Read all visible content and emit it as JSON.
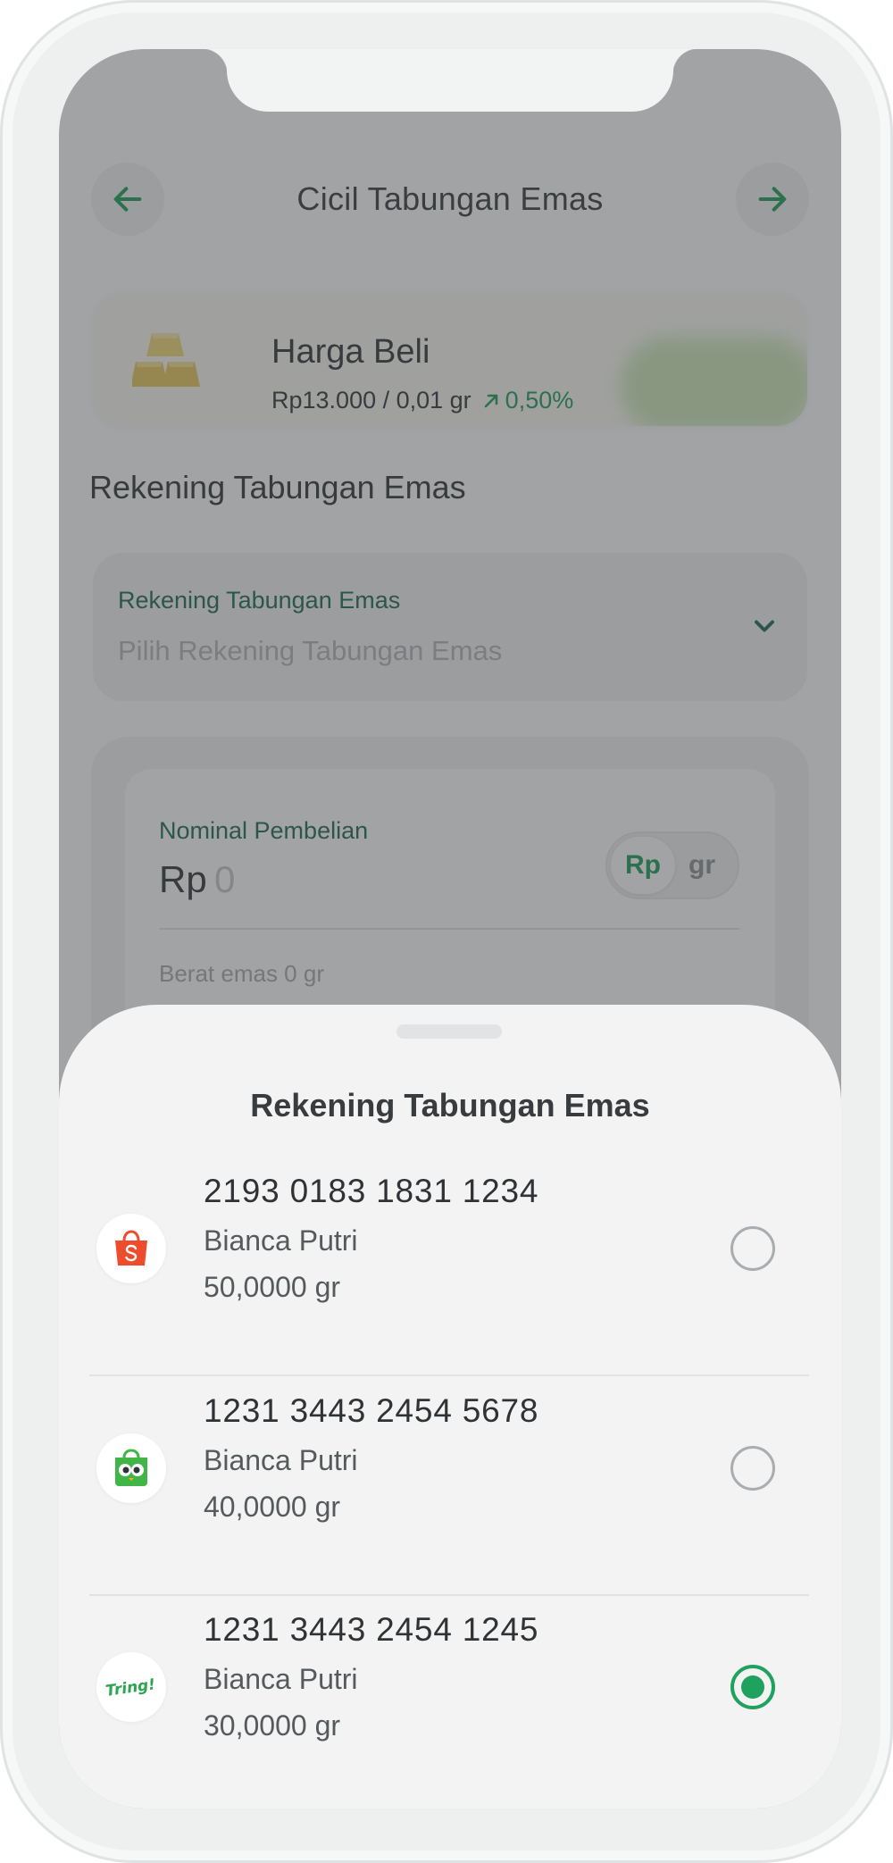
{
  "header": {
    "title": "Cicil Tabungan Emas",
    "back_icon": "arrow-left-icon",
    "forward_icon": "arrow-right-icon"
  },
  "price_card": {
    "label": "Harga Beli",
    "price": "Rp13.000 / 0,01 gr",
    "change": "0,50%",
    "change_icon": "arrow-up-right-icon",
    "accent": "#1f9d5c"
  },
  "section_title": "Rekening Tabungan Emas",
  "account_select": {
    "label": "Rekening Tabungan Emas",
    "placeholder": "Pilih Rekening Tabungan Emas"
  },
  "amount": {
    "label": "Nominal Pembelian",
    "currency": "Rp",
    "value": "0",
    "unit_rp": "Rp",
    "unit_gr": "gr",
    "weight_text": "Berat emas 0 gr"
  },
  "sheet": {
    "title": "Rekening Tabungan Emas",
    "accounts": [
      {
        "number": "2193 0183 1831 1234",
        "name": "Bianca Putri",
        "weight": "50,0000 gr",
        "logo": "shopee-bag-icon",
        "selected": false
      },
      {
        "number": "1231 3443 2454 5678",
        "name": "Bianca Putri",
        "weight": "40,0000 gr",
        "logo": "tokopedia-owl-icon",
        "selected": false
      },
      {
        "number": "1231 3443 2454 1245",
        "name": "Bianca Putri",
        "weight": "30,0000 gr",
        "logo": "tring-logo",
        "selected": true,
        "logo_text": "Tring!"
      }
    ]
  }
}
